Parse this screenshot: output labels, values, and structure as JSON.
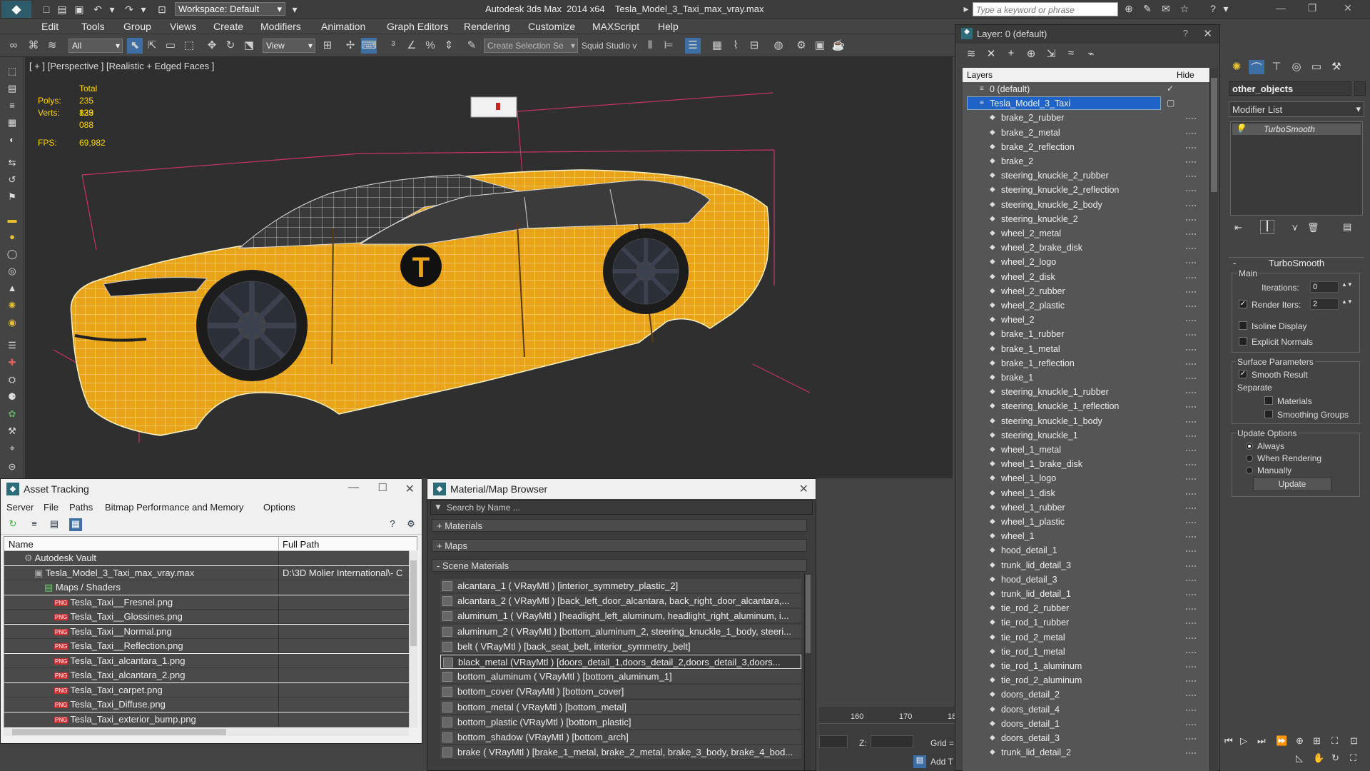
{
  "app": {
    "title": "Autodesk 3ds Max  2014 x64",
    "file": "Tesla_Model_3_Taxi_max_vray.max",
    "workspace": "Workspace: Default",
    "search_placeholder": "Type a keyword or phrase"
  },
  "menu": [
    "Edit",
    "Tools",
    "Group",
    "Views",
    "Create",
    "Modifiers",
    "Animation",
    "Graph Editors",
    "Rendering",
    "Customize",
    "MAXScript",
    "Help"
  ],
  "toolbar": {
    "filter": "All",
    "refcoord": "View",
    "selection_set": "Create Selection Se",
    "studio": "Squid Studio v"
  },
  "viewport": {
    "label": "[ + ] [Perspective ] [Realistic + Edged Faces ]",
    "stats": {
      "total_label": "Total",
      "polys_label": "Polys:",
      "polys": "235 829",
      "verts_label": "Verts:",
      "verts": "133 088",
      "fps_label": "FPS:",
      "fps": "69,982"
    },
    "taxi_letter": "T"
  },
  "asset_tracking": {
    "title": "Asset Tracking",
    "menu": [
      "Server",
      "File",
      "Paths",
      "Bitmap Performance and Memory",
      "Options"
    ],
    "col_name": "Name",
    "col_path": "Full Path",
    "rows": [
      {
        "name": "Autodesk Vault",
        "path": "",
        "indent": 1,
        "kind": "vault"
      },
      {
        "name": "Tesla_Model_3_Taxi_max_vray.max",
        "path": "D:\\3D Molier International\\- C",
        "indent": 2,
        "kind": "max"
      },
      {
        "name": "Maps / Shaders",
        "path": "",
        "indent": 3,
        "kind": "folder"
      },
      {
        "name": "Tesla_Taxi__Fresnel.png",
        "path": "",
        "indent": 4,
        "kind": "png"
      },
      {
        "name": "Tesla_Taxi__Glossines.png",
        "path": "",
        "indent": 4,
        "kind": "png"
      },
      {
        "name": "Tesla_Taxi__Normal.png",
        "path": "",
        "indent": 4,
        "kind": "png"
      },
      {
        "name": "Tesla_Taxi__Reflection.png",
        "path": "",
        "indent": 4,
        "kind": "png"
      },
      {
        "name": "Tesla_Taxi_alcantara_1.png",
        "path": "",
        "indent": 4,
        "kind": "png"
      },
      {
        "name": "Tesla_Taxi_alcantara_2.png",
        "path": "",
        "indent": 4,
        "kind": "png"
      },
      {
        "name": "Tesla_Taxi_carpet.png",
        "path": "",
        "indent": 4,
        "kind": "png"
      },
      {
        "name": "Tesla_Taxi_Diffuse.png",
        "path": "",
        "indent": 4,
        "kind": "png"
      },
      {
        "name": "Tesla_Taxi_exterior_bump.png",
        "path": "",
        "indent": 4,
        "kind": "png"
      }
    ]
  },
  "material_browser": {
    "title": "Material/Map Browser",
    "search_placeholder": "Search by Name ...",
    "sections": [
      "+ Materials",
      "+ Maps",
      "- Scene Materials"
    ],
    "items": [
      "alcantara_1  ( VRayMtl ) [interior_symmetry_plastic_2]",
      "alcantara_2  ( VRayMtl ) [back_left_door_alcantara, back_right_door_alcantara,...",
      "aluminum_1  ( VRayMtl ) [headlight_left_aluminum, headlight_right_aluminum, i...",
      "aluminum_2  ( VRayMtl ) [bottom_aluminum_2, steering_knuckle_1_body, steeri...",
      "belt  ( VRayMtl ) [back_seat_belt, interior_symmetry_belt]",
      "black_metal  (VRayMtl ) [doors_detail_1,doors_detail_2,doors_detail_3,doors...",
      "bottom_aluminum  ( VRayMtl ) [bottom_aluminum_1]",
      "bottom_cover  (VRayMtl ) [bottom_cover]",
      "bottom_metal  ( VRayMtl ) [bottom_metal]",
      "bottom_plastic  (VRayMtl ) [bottom_plastic]",
      "bottom_shadow  (VRayMtl ) [bottom_arch]",
      "brake  ( VRayMtl ) [brake_1_metal, brake_2_metal, brake_3_body, brake_4_bod..."
    ],
    "selected_index": 5
  },
  "layers": {
    "title": "Layer: 0 (default)",
    "col_layers": "Layers",
    "col_hide": "Hide",
    "rows": [
      {
        "name": "0 (default)",
        "level": 0
      },
      {
        "name": "Tesla_Model_3_Taxi",
        "level": 0,
        "selected": true
      },
      {
        "name": "brake_2_rubber",
        "level": 1
      },
      {
        "name": "brake_2_metal",
        "level": 1
      },
      {
        "name": "brake_2_reflection",
        "level": 1
      },
      {
        "name": "brake_2",
        "level": 1
      },
      {
        "name": "steering_knuckle_2_rubber",
        "level": 1
      },
      {
        "name": "steering_knuckle_2_reflection",
        "level": 1
      },
      {
        "name": "steering_knuckle_2_body",
        "level": 1
      },
      {
        "name": "steering_knuckle_2",
        "level": 1
      },
      {
        "name": "wheel_2_metal",
        "level": 1
      },
      {
        "name": "wheel_2_brake_disk",
        "level": 1
      },
      {
        "name": "wheel_2_logo",
        "level": 1
      },
      {
        "name": "wheel_2_disk",
        "level": 1
      },
      {
        "name": "wheel_2_rubber",
        "level": 1
      },
      {
        "name": "wheel_2_plastic",
        "level": 1
      },
      {
        "name": "wheel_2",
        "level": 1
      },
      {
        "name": "brake_1_rubber",
        "level": 1
      },
      {
        "name": "brake_1_metal",
        "level": 1
      },
      {
        "name": "brake_1_reflection",
        "level": 1
      },
      {
        "name": "brake_1",
        "level": 1
      },
      {
        "name": "steering_knuckle_1_rubber",
        "level": 1
      },
      {
        "name": "steering_knuckle_1_reflection",
        "level": 1
      },
      {
        "name": "steering_knuckle_1_body",
        "level": 1
      },
      {
        "name": "steering_knuckle_1",
        "level": 1
      },
      {
        "name": "wheel_1_metal",
        "level": 1
      },
      {
        "name": "wheel_1_brake_disk",
        "level": 1
      },
      {
        "name": "wheel_1_logo",
        "level": 1
      },
      {
        "name": "wheel_1_disk",
        "level": 1
      },
      {
        "name": "wheel_1_rubber",
        "level": 1
      },
      {
        "name": "wheel_1_plastic",
        "level": 1
      },
      {
        "name": "wheel_1",
        "level": 1
      },
      {
        "name": "hood_detail_1",
        "level": 1
      },
      {
        "name": "trunk_lid_detail_3",
        "level": 1
      },
      {
        "name": "hood_detail_3",
        "level": 1
      },
      {
        "name": "trunk_lid_detail_1",
        "level": 1
      },
      {
        "name": "tie_rod_2_rubber",
        "level": 1
      },
      {
        "name": "tie_rod_1_rubber",
        "level": 1
      },
      {
        "name": "tie_rod_2_metal",
        "level": 1
      },
      {
        "name": "tie_rod_1_metal",
        "level": 1
      },
      {
        "name": "tie_rod_1_aluminum",
        "level": 1
      },
      {
        "name": "tie_rod_2_aluminum",
        "level": 1
      },
      {
        "name": "doors_detail_2",
        "level": 1
      },
      {
        "name": "doors_detail_4",
        "level": 1
      },
      {
        "name": "doors_detail_1",
        "level": 1
      },
      {
        "name": "doors_detail_3",
        "level": 1
      },
      {
        "name": "trunk_lid_detail_2",
        "level": 1
      }
    ]
  },
  "command_panel": {
    "object_name": "other_objects",
    "modifier_list": "Modifier List",
    "stack_item": "TurboSmooth",
    "rollout_title": "TurboSmooth",
    "main_label": "Main",
    "iterations_label": "Iterations:",
    "iterations": "0",
    "render_iters_label": "Render Iters:",
    "render_iters": "2",
    "isoline_label": "Isoline Display",
    "explicit_label": "Explicit Normals",
    "surface_label": "Surface Parameters",
    "smooth_label": "Smooth Result",
    "separate_label": "Separate",
    "materials_label": "Materials",
    "smoothing_label": "Smoothing Groups",
    "update_opts_label": "Update Options",
    "always_label": "Always",
    "when_rendering_label": "When Rendering",
    "manually_label": "Manually",
    "update_button": "Update"
  },
  "timeline": {
    "tick160": "160",
    "tick170": "170",
    "tick180": "18",
    "z_label": "Z:",
    "grid_label": "Grid =",
    "addt_label": "Add T"
  },
  "colors": {
    "taxi_yellow": "#e8a318",
    "selection_blue": "#1f63c9",
    "stats_yellow": "#ffd800"
  }
}
